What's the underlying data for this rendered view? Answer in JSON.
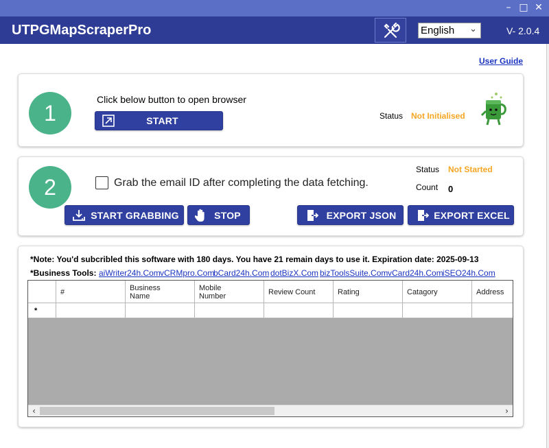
{
  "header": {
    "title": "UTPGMapScraperPro",
    "language": "English",
    "version": "V- 2.0.4"
  },
  "window_controls": {
    "minimize": "–",
    "maximize": "□",
    "close": "✕"
  },
  "user_guide": "User Guide",
  "step1": {
    "number": "1",
    "instruction": "Click below button to open browser",
    "start_label": "START",
    "status_label": "Status",
    "status_value": "Not Initialised"
  },
  "step2": {
    "number": "2",
    "checkbox_label": "Grab the email ID after completing the data fetching.",
    "status_label": "Status",
    "status_value": "Not Started",
    "count_label": "Count",
    "count_value": "0",
    "buttons": {
      "start_grabbing": "START GRABBING",
      "stop": "STOP",
      "export_json": "EXPORT JSON",
      "export_excel": "EXPORT EXCEL"
    }
  },
  "note": "*Note: You'd subcribled this software with 180 days. You have 21 remain days to use it. Expiration date: 2025-09-13",
  "business_tools": {
    "label": "*Business Tools:",
    "links": [
      "aiWriter24h.Com",
      "vCRMpro.Com",
      "bCard24h.Com",
      "dotBizX.Com",
      "bizToolsSuite.Com",
      "vCard24h.Com",
      "iSEO24h.Com"
    ]
  },
  "grid": {
    "columns": [
      "#",
      "Business\nName",
      "Mobile\nNumber",
      "Review Count",
      "Rating",
      "Catagory",
      "Address"
    ],
    "new_row_marker": "*"
  },
  "colors": {
    "header_bg": "#2f3c96",
    "button_bg": "#3040a0",
    "step_green": "#4bb38a",
    "status_orange": "#f5a623",
    "link_blue": "#1a33c0"
  }
}
